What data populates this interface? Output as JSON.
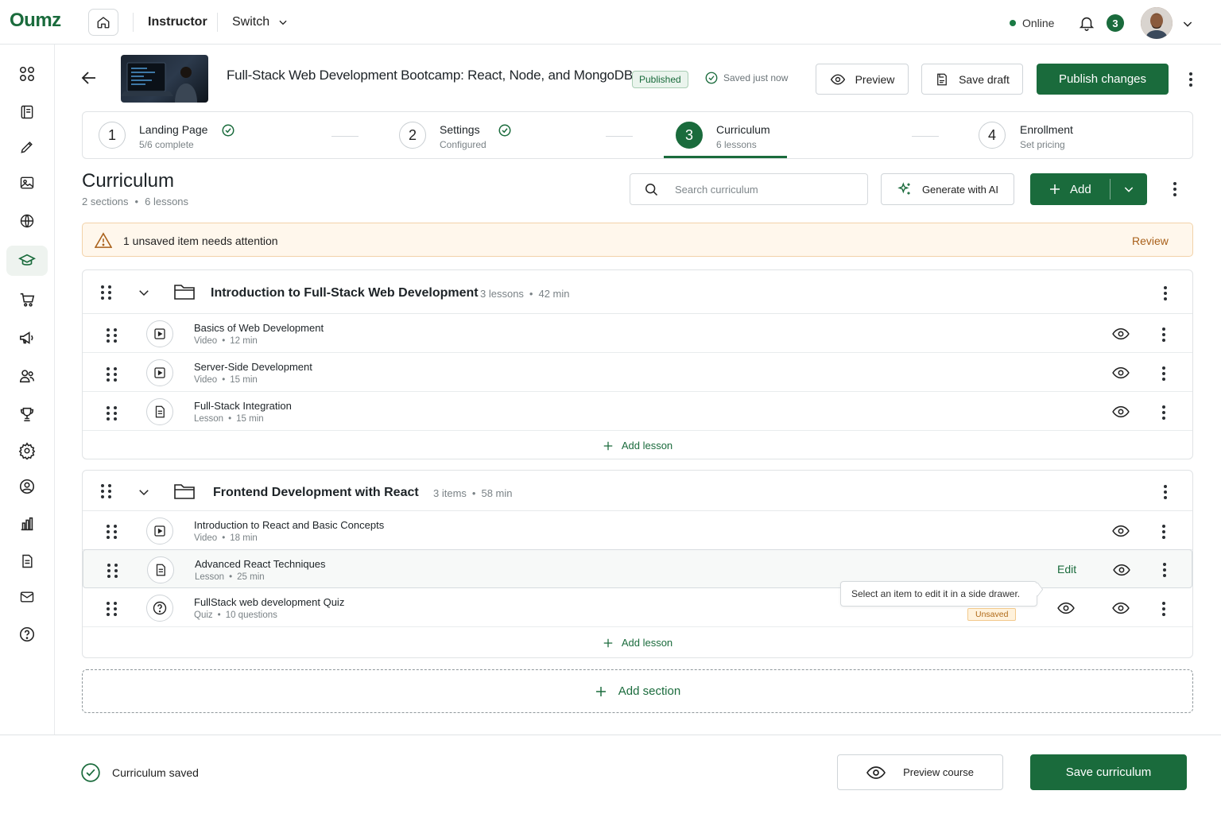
{
  "app": {
    "logo": "Oumz",
    "role": "Instructor",
    "switch_label": "Switch",
    "status": "Online",
    "notifications": "3"
  },
  "course": {
    "title": "Full-Stack Web Development Bootcamp: React, Node, and MongoDB",
    "status_badge": "Published",
    "save_status": "Saved just now",
    "preview_label": "Preview",
    "save_draft_label": "Save draft",
    "publish_label": "Publish changes"
  },
  "steps": [
    {
      "num": "1",
      "name": "Landing Page",
      "sub": "5/6 complete",
      "done": true
    },
    {
      "num": "2",
      "name": "Settings",
      "sub": "Configured",
      "done": true
    },
    {
      "num": "3",
      "name": "Curriculum",
      "sub": "6 lessons",
      "active": true
    },
    {
      "num": "4",
      "name": "Enrollment",
      "sub": "Set pricing"
    }
  ],
  "curriculum": {
    "title": "Curriculum",
    "sections_count": "2 sections",
    "lessons_count": "6 lessons",
    "search_placeholder": "Search curriculum",
    "generate_label": "Generate with AI",
    "add_label": "Add"
  },
  "alert": {
    "text": "1 unsaved item needs attention",
    "action": "Review"
  },
  "sections": [
    {
      "title": "Introduction to Full-Stack Web Development",
      "count": "3 lessons",
      "duration": "42 min",
      "add_lesson": "Add lesson",
      "lessons": [
        {
          "title": "Basics of Web Development",
          "type": "Video",
          "detail": "12 min",
          "icon": "video-icon"
        },
        {
          "title": "Server-Side Development",
          "type": "Video",
          "detail": "15 min",
          "icon": "video-icon"
        },
        {
          "title": "Full-Stack Integration",
          "type": "Lesson",
          "detail": "15 min",
          "icon": "document-icon"
        }
      ]
    },
    {
      "title": "Frontend Development with React",
      "count": "3 items",
      "duration": "58 min",
      "add_lesson": "Add lesson",
      "lessons": [
        {
          "title": "Introduction to React and Basic Concepts",
          "type": "Video",
          "detail": "18 min",
          "icon": "video-icon"
        },
        {
          "title": "Advanced React Techniques",
          "type": "Lesson",
          "detail": "25 min",
          "icon": "document-icon",
          "edit_label": "Edit"
        },
        {
          "title": "FullStack web development Quiz",
          "type": "Quiz",
          "detail": "10 questions",
          "icon": "question-icon",
          "badge": "Unsaved"
        }
      ]
    }
  ],
  "tooltip": "Select an item to edit it in a side drawer.",
  "add_section": "Add section",
  "footer": {
    "status": "Curriculum saved",
    "preview_label": "Preview course",
    "save_label": "Save curriculum"
  },
  "colors": {
    "brand": "#1a6b3c",
    "warning_bg": "#fff7ec",
    "warning_text": "#a9601a"
  }
}
